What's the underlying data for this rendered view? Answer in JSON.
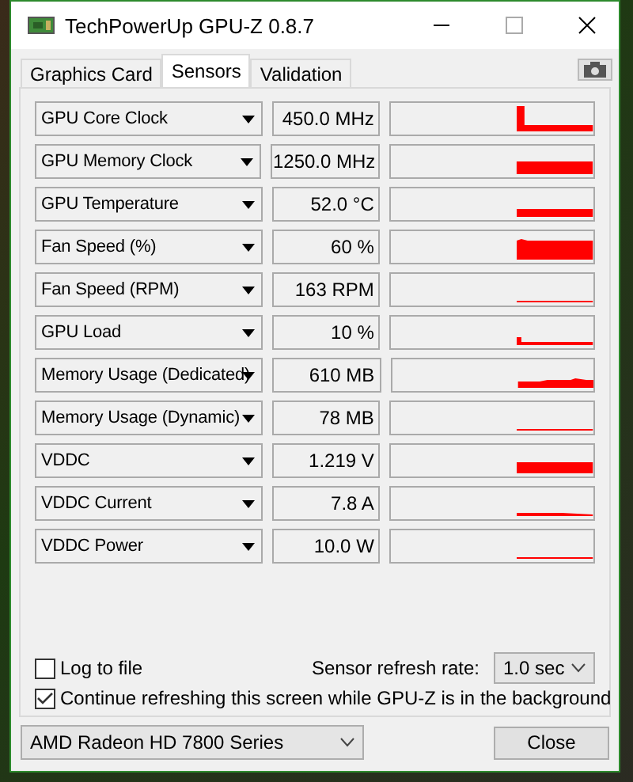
{
  "window": {
    "title": "TechPowerUp GPU-Z 0.8.7"
  },
  "tabs": [
    {
      "label": "Graphics Card",
      "selected": false
    },
    {
      "label": "Sensors",
      "selected": true
    },
    {
      "label": "Validation",
      "selected": false
    }
  ],
  "sensors": [
    {
      "name": "GPU Core Clock",
      "value": "450.0 MHz"
    },
    {
      "name": "GPU Memory Clock",
      "value": "1250.0 MHz"
    },
    {
      "name": "GPU Temperature",
      "value": "52.0 °C"
    },
    {
      "name": "Fan Speed (%)",
      "value": "60 %"
    },
    {
      "name": "Fan Speed (RPM)",
      "value": "163 RPM"
    },
    {
      "name": "GPU Load",
      "value": "10 %"
    },
    {
      "name": "Memory Usage (Dedicated)",
      "value": "610 MB"
    },
    {
      "name": "Memory Usage (Dynamic)",
      "value": "78 MB"
    },
    {
      "name": "VDDC",
      "value": "1.219 V"
    },
    {
      "name": "VDDC Current",
      "value": "7.8 A"
    },
    {
      "name": "VDDC Power",
      "value": "10.0 W"
    }
  ],
  "options": [
    {
      "label": "Log to file",
      "checked": false
    },
    {
      "label": "Continue refreshing this screen while GPU-Z is in the background",
      "checked": true
    }
  ],
  "refresh_rate": {
    "label": "Sensor refresh rate:",
    "value": "1.0 sec"
  },
  "device": {
    "value": "AMD Radeon HD 7800 Series"
  },
  "close_button": "Close"
}
